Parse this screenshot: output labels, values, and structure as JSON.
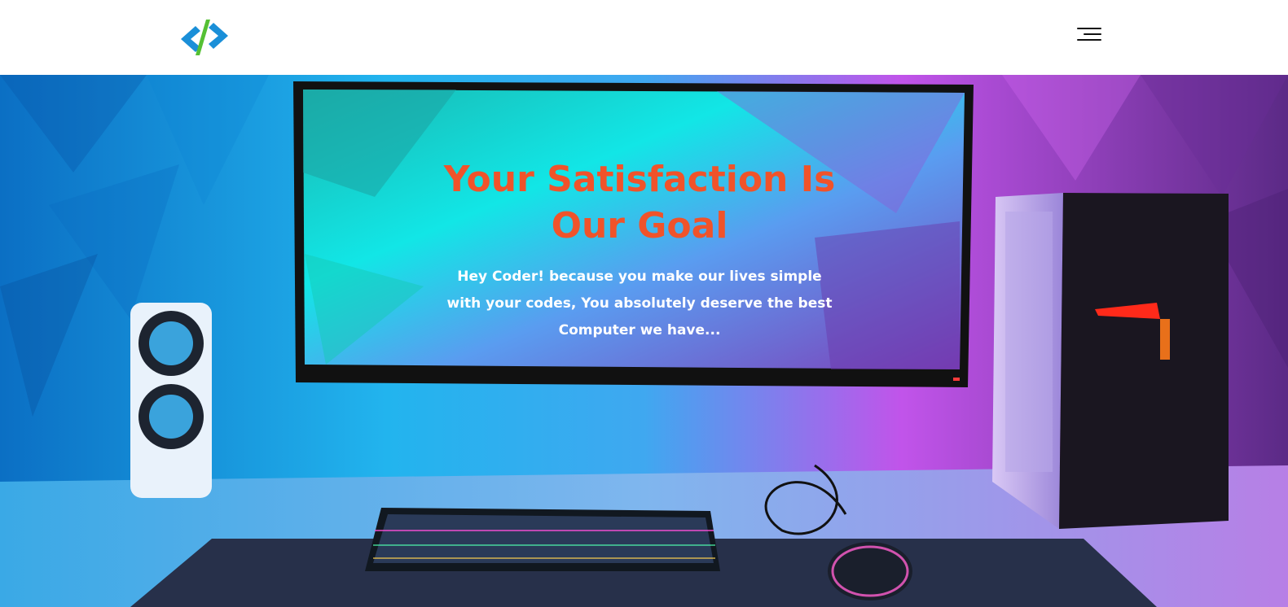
{
  "header": {
    "logo_icon": "code-brackets-logo",
    "menu_icon": "hamburger-menu-icon",
    "logo_colors": {
      "blue": "#1a8fd8",
      "green": "#55c034"
    }
  },
  "hero": {
    "title": "Your Satisfaction Is Our Goal",
    "subtitle": "Hey Coder! because you make our lives simple with your codes, You absolutely deserve the best Computer we have...",
    "title_color": "#f0532a",
    "subtitle_color": "#ffffff",
    "background_image": "gaming desk setup with curved monitor, speaker, PC tower, RGB keyboard and mouse"
  }
}
